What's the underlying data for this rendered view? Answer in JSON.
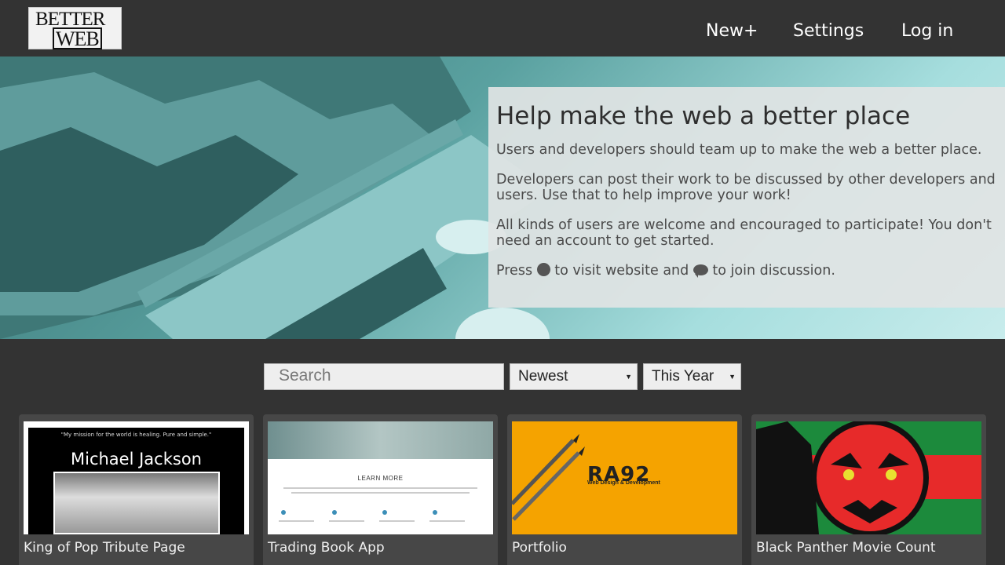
{
  "header": {
    "logo_line1": "BETTER",
    "logo_line2": "WEB",
    "nav": [
      "New+",
      "Settings",
      "Log in"
    ]
  },
  "hero": {
    "title": "Help make the web a better place",
    "p1": "Users and developers should team up to make the web a better place.",
    "p2": "Developers can post their work to be discussed by other developers and users. Use that to help improve your work!",
    "p3": "All kinds of users are welcome and encouraged to participate! You don't need an account to get started.",
    "p4_before": "Press",
    "p4_mid": "to visit website and",
    "p4_after": "to join discussion.",
    "icons": [
      "globe-icon",
      "comment-icon"
    ]
  },
  "filters": {
    "search_placeholder": "Search",
    "sort_selected": "Newest",
    "range_selected": "This Year"
  },
  "cards": [
    {
      "title": "King of Pop Tribute Page",
      "thumb_quote": "\"My mission for the world is healing. Pure and simple.\"",
      "thumb_name": "Michael Jackson"
    },
    {
      "title": "Trading Book App",
      "thumb_heading": "LEARN MORE"
    },
    {
      "title": "Portfolio",
      "thumb_logo": "RA92",
      "thumb_sub": "Web Design & Development"
    },
    {
      "title": "Black Panther Movie Count"
    }
  ],
  "colors": {
    "background": "#333333",
    "card": "#474747",
    "hero_overlay": "#e1e4e4",
    "portfolio_orange": "#f5a300",
    "panther_red": "#e72a2a",
    "panther_green": "#1c8a3c"
  }
}
